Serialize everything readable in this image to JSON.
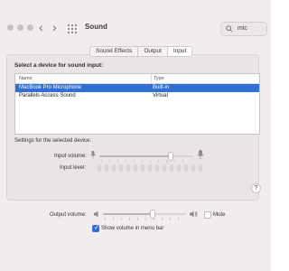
{
  "window": {
    "title": "Sound",
    "search_value": "mic"
  },
  "tabs": [
    {
      "label": "Sound Effects",
      "active": false
    },
    {
      "label": "Output",
      "active": false
    },
    {
      "label": "Input",
      "active": true
    }
  ],
  "input": {
    "heading": "Select a device for sound input:",
    "columns": [
      "Name",
      "Type"
    ],
    "rows": [
      {
        "name": "MacBook Pro Microphone",
        "type": "Built-in",
        "selected": true
      },
      {
        "name": "Parallels Access Sound",
        "type": "Virtual",
        "selected": false
      }
    ],
    "settings_heading": "Settings for the selected device:",
    "volume_label": "Input volume:",
    "volume_level": 0.76,
    "level_label": "Input level:",
    "level_segments": 15
  },
  "output": {
    "volume_label": "Output volume:",
    "volume_level": 0.6,
    "mute_label": "Mute",
    "muted": false,
    "show_in_menu_label": "Show volume in menu bar",
    "show_in_menu": true
  },
  "colors": {
    "accent": "#2f6fd8",
    "window_bg": "#f3ecec"
  }
}
